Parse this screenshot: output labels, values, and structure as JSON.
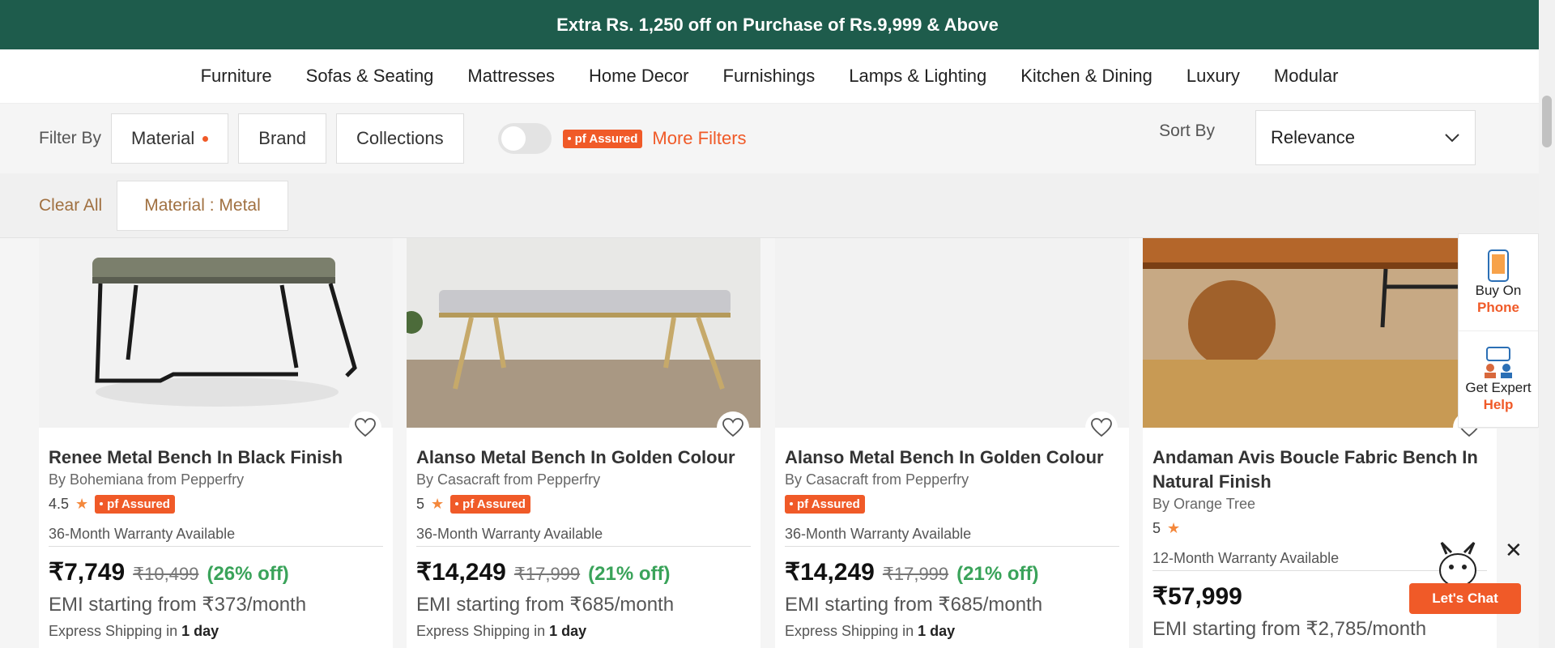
{
  "promo": {
    "text": "Extra Rs. 1,250 off on Purchase of Rs.9,999 & Above"
  },
  "nav": {
    "items": [
      "Furniture",
      "Sofas & Seating",
      "Mattresses",
      "Home Decor",
      "Furnishings",
      "Lamps & Lighting",
      "Kitchen & Dining",
      "Luxury",
      "Modular"
    ]
  },
  "filters": {
    "label": "Filter By",
    "buttons": [
      "Material",
      "Brand",
      "Collections"
    ],
    "assured_badge": "pf Assured",
    "more": "More Filters",
    "sort_label": "Sort By",
    "sort_value": "Relevance",
    "clear_all": "Clear All",
    "applied_chip": "Material : Metal"
  },
  "products": [
    {
      "title": "Renee Metal Bench In Black Finish",
      "brand": "By Bohemiana from Pepperfry",
      "rating": "4.5",
      "assured": "pf Assured",
      "warranty": "36-Month Warranty Available",
      "price": "₹7,749",
      "mrp": "₹10,499",
      "off": "(26% off)",
      "emi": "EMI starting from ₹373/month",
      "ship_prefix": "Express Shipping in ",
      "ship_days": "1 day"
    },
    {
      "title": "Alanso Metal Bench In Golden Colour",
      "brand": "By Casacraft from Pepperfry",
      "rating": "5",
      "assured": "pf Assured",
      "warranty": "36-Month Warranty Available",
      "price": "₹14,249",
      "mrp": "₹17,999",
      "off": "(21% off)",
      "emi": "EMI starting from ₹685/month",
      "ship_prefix": "Express Shipping in ",
      "ship_days": "1 day"
    },
    {
      "title": "Alanso Metal Bench In Golden Colour",
      "brand": "By Casacraft from Pepperfry",
      "rating": "",
      "assured": "pf Assured",
      "warranty": "36-Month Warranty Available",
      "price": "₹14,249",
      "mrp": "₹17,999",
      "off": "(21% off)",
      "emi": "EMI starting from ₹685/month",
      "ship_prefix": "Express Shipping in ",
      "ship_days": "1 day"
    },
    {
      "title": "Andaman Avis Boucle Fabric Bench In Natural Finish",
      "brand": "By Orange Tree",
      "rating": "5",
      "assured": "",
      "warranty": "12-Month Warranty Available",
      "price": "₹57,999",
      "mrp": "",
      "off": "",
      "emi": "EMI starting from ₹2,785/month",
      "ship_prefix": "",
      "ship_days": ""
    }
  ],
  "side_widget": {
    "buy_line1": "Buy On",
    "buy_line2": "Phone",
    "help_line1": "Get Expert",
    "help_line2": "Help"
  },
  "chat": {
    "label": "Let's Chat",
    "close": "✕"
  },
  "colors": {
    "brand_green": "#1e5c4c",
    "accent_orange": "#f05a28",
    "discount_green": "#3aa35a"
  }
}
